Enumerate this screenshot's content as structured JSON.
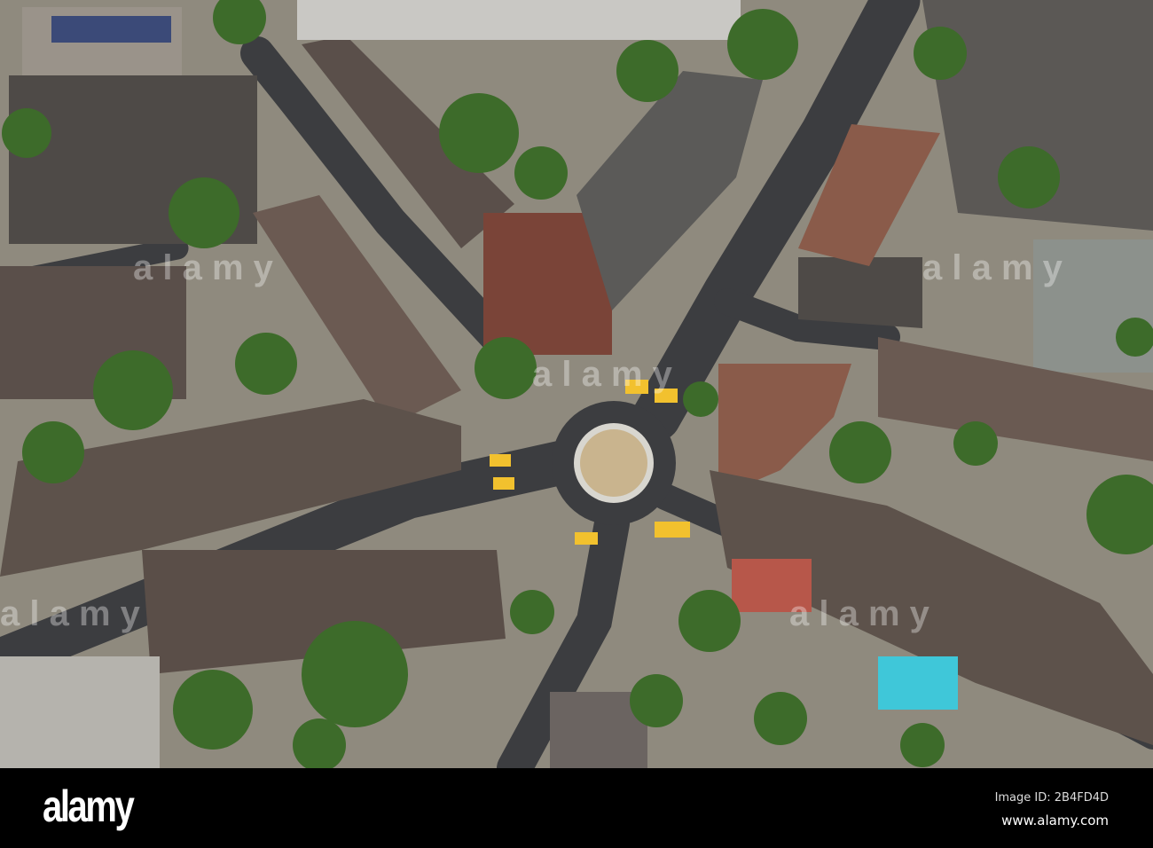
{
  "photo": {
    "subject": "roundabout",
    "watermark_text": "alamy",
    "colors": {
      "asphalt": "#3c3d40",
      "roof_dark": "#5a4f4a",
      "roof_red": "#8a5b4a",
      "tree": "#3d6b2a",
      "ground": "#8f8a7e",
      "crossing": "#f2c12e",
      "island": "#c9b48e"
    }
  },
  "footer": {
    "logo": "alamy",
    "image_id": "Image ID: 2B4FD4D",
    "url": "www.alamy.com"
  }
}
